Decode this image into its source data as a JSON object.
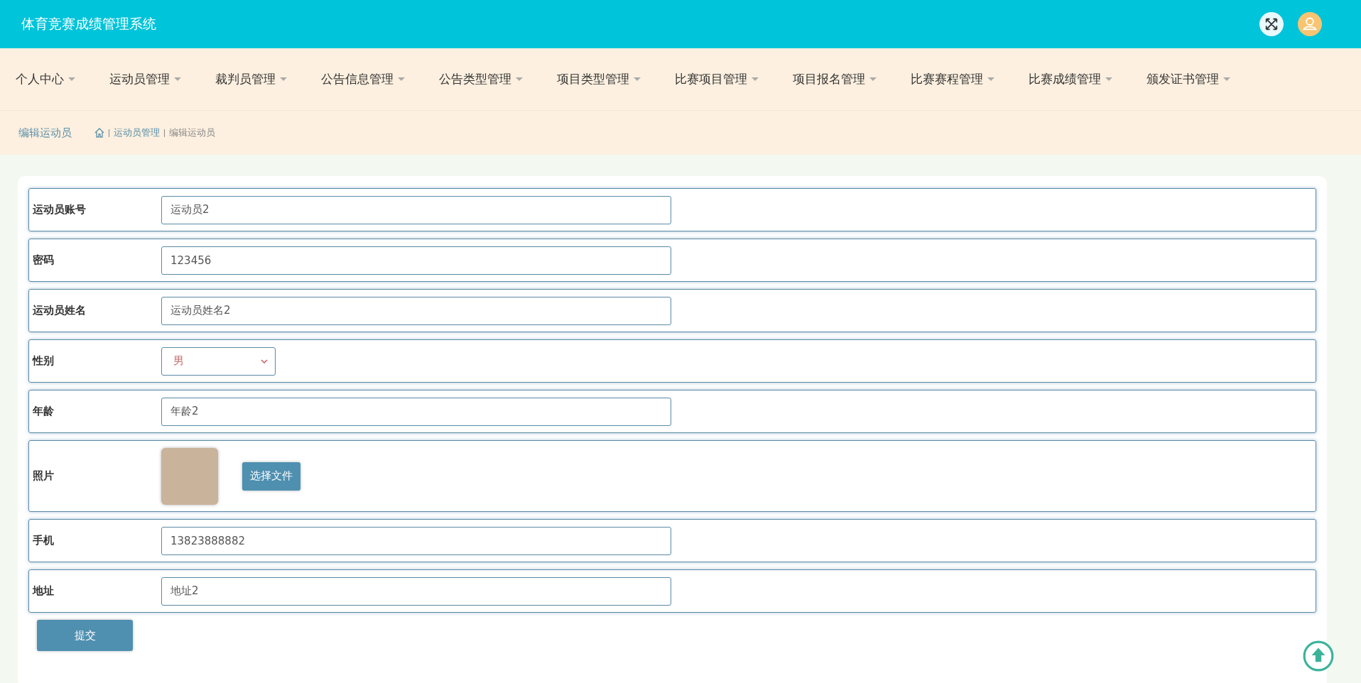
{
  "header": {
    "title": "体育竞赛成绩管理系统"
  },
  "nav": [
    {
      "label": "个人中心"
    },
    {
      "label": "运动员管理"
    },
    {
      "label": "裁判员管理"
    },
    {
      "label": "公告信息管理"
    },
    {
      "label": "公告类型管理"
    },
    {
      "label": "项目类型管理"
    },
    {
      "label": "比赛项目管理"
    },
    {
      "label": "项目报名管理"
    },
    {
      "label": "比赛赛程管理"
    },
    {
      "label": "比赛成绩管理"
    },
    {
      "label": "颁发证书管理"
    }
  ],
  "breadcrumb": {
    "title": "编辑运动员",
    "items": [
      "运动员管理",
      "编辑运动员"
    ]
  },
  "fields": [
    {
      "kind": "text",
      "label": "运动员账号",
      "value": "运动员2"
    },
    {
      "kind": "text",
      "label": "密码",
      "value": "123456"
    },
    {
      "kind": "text",
      "label": "运动员姓名",
      "value": "运动员姓名2"
    },
    {
      "kind": "select",
      "label": "性别",
      "value": "男"
    },
    {
      "kind": "text",
      "label": "年龄",
      "value": "年龄2"
    },
    {
      "kind": "image",
      "label": "照片",
      "button": "选择文件"
    },
    {
      "kind": "text",
      "label": "手机",
      "value": "13823888882"
    },
    {
      "kind": "text",
      "label": "地址",
      "value": "地址2"
    }
  ],
  "submit": "提交"
}
